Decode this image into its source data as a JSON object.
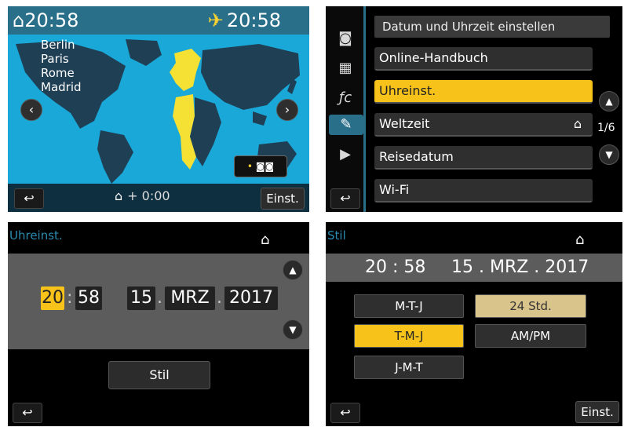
{
  "colors": {
    "accent": "#f7c31a",
    "teal": "#2a6f8a",
    "map_water": "#1aa8d8",
    "land": "#1f3f55"
  },
  "world_time": {
    "home_time": "20:58",
    "dest_time": "20:58",
    "cities": [
      "Berlin",
      "Paris",
      "Rome",
      "Madrid"
    ],
    "offset": "+ 0:00",
    "set_label": "Einst.",
    "icons": {
      "home": "home-icon",
      "plane": "plane-icon",
      "dst": "daylight-saving-icon"
    }
  },
  "menu": {
    "header": "Datum und Uhrzeit einstellen",
    "items": [
      {
        "label": "Online-Handbuch",
        "selected": false
      },
      {
        "label": "Uhreinst.",
        "selected": true
      },
      {
        "label": "Weltzeit",
        "selected": false
      },
      {
        "label": "Reisedatum",
        "selected": false
      },
      {
        "label": "Wi-Fi",
        "selected": false
      }
    ],
    "page": "1/6",
    "side_icons": [
      "camera-icon",
      "video-icon",
      "custom-fc-icon",
      "wrench-icon",
      "playback-icon"
    ]
  },
  "clock_set": {
    "title": "Uhreinst.",
    "hour": "20",
    "minute": "58",
    "day": "15",
    "month": "MRZ",
    "year": "2017",
    "style_button": "Stil"
  },
  "style": {
    "title": "Stil",
    "time": "20 : 58",
    "date": "15 . MRZ . 2017",
    "date_orders": [
      "M-T-J",
      "T-M-J",
      "J-M-T"
    ],
    "time_formats": [
      "24 Std.",
      "AM/PM"
    ],
    "set_label": "Einst."
  }
}
